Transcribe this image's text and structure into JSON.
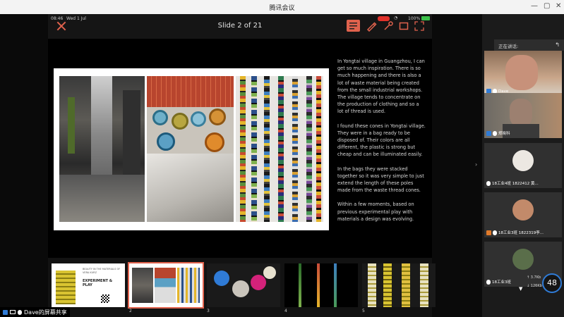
{
  "window": {
    "title": "腾讯会议"
  },
  "status": {
    "time": "08:46",
    "date": "Wed 1 Jul",
    "battery": "100%"
  },
  "toolbar": {
    "slide_counter": "Slide 2 of 21"
  },
  "slide": {
    "paragraphs": [
      "In Yongtai village in Guangzhou, I can get so much inspiration. There is so much happening and there is also a lot of waste material being created from the small  industrial workshops. The village tends to concentrate on the production of clothing and so a lot of thread is used.",
      "I found these cones in Yongtai village. They were in a bag ready to be disposed of. Their colors are all different, the plastic is strong but cheap and can be illuminated easily.",
      "In the bags they were stacked together so it was very simple to just extend the length of these poles made from the waste thread cones.",
      "Within a few moments, based on previous experimental play with materials a design was evolving."
    ]
  },
  "thumbnails": [
    {
      "number": "",
      "heading": "BEAUTY IN THE MATERIALS OF VERA KURZ",
      "title": "EXPERIMENT & PLAY"
    },
    {
      "number": "2"
    },
    {
      "number": "3"
    },
    {
      "number": "4"
    },
    {
      "number": "5"
    }
  ],
  "sidebar": {
    "speaking_label": "正在讲话:",
    "participants": [
      {
        "name": "Dave"
      },
      {
        "name": "郑晓科"
      },
      {
        "name": "18工业4班 1822412 黄..."
      },
      {
        "name": "18工业3班 1822319李..."
      },
      {
        "name": "18工业3班"
      }
    ]
  },
  "network": {
    "score": "48",
    "up": "3.7Kb",
    "down": "126Kb"
  },
  "share_label": "Dave的屏幕共享",
  "colors": {
    "accent": "#e0624d",
    "brand": "#2f7bd6"
  }
}
